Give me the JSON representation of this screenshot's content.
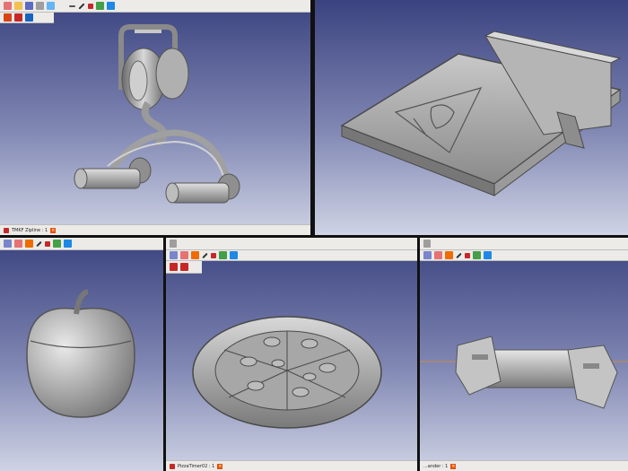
{
  "panels": [
    {
      "id": "zipline",
      "tab_label": "TMKF Zipline : 1"
    },
    {
      "id": "phone-stand",
      "tab_label": ""
    },
    {
      "id": "apple",
      "tab_label": ""
    },
    {
      "id": "pizza",
      "tab_label": "PizzaTimer02 : 1"
    },
    {
      "id": "dumbbell",
      "tab_label": "...ander : 1"
    }
  ],
  "colors": {
    "background_top": "#3b4380",
    "background_bottom": "#cfd3e4",
    "model_fill": "#a9a9a9",
    "toolbar": "#ecebe8",
    "separator": "#111111"
  },
  "icons": [
    "new-file-icon",
    "open-folder-icon",
    "save-icon",
    "undo-icon",
    "redo-icon",
    "refresh-icon",
    "macro-icon",
    "play-icon",
    "measure-icon",
    "axis-icon",
    "workbench-icon"
  ]
}
